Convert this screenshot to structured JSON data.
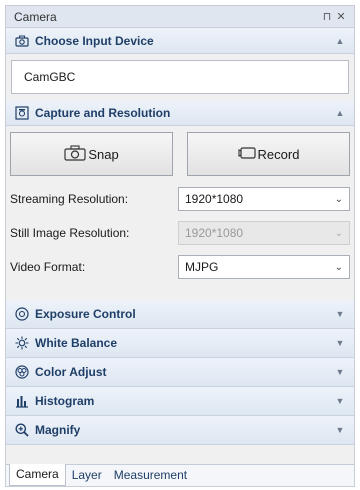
{
  "window": {
    "title": "Camera",
    "pin_glyph": "⊓",
    "close_glyph": "✕"
  },
  "sections": {
    "input_device": {
      "title": "Choose Input Device",
      "icon": "camera-icon",
      "device": "CamGBC"
    },
    "capture": {
      "title": "Capture and Resolution",
      "icon": "capture-icon",
      "snap_label": "Snap",
      "record_label": "Record",
      "streaming_label": "Streaming Resolution:",
      "streaming_value": "1920*1080",
      "still_label": "Still Image Resolution:",
      "still_value": "1920*1080",
      "format_label": "Video Format:",
      "format_value": "MJPG"
    },
    "exposure": {
      "title": "Exposure Control",
      "icon": "exposure-icon"
    },
    "white_balance": {
      "title": "White Balance",
      "icon": "white-balance-icon"
    },
    "color_adjust": {
      "title": "Color Adjust",
      "icon": "color-adjust-icon"
    },
    "histogram": {
      "title": "Histogram",
      "icon": "histogram-icon"
    },
    "magnify": {
      "title": "Magnify",
      "icon": "magnify-icon"
    }
  },
  "tabs": [
    "Camera",
    "Layer",
    "Measurement"
  ],
  "colors": {
    "header_text": "#1f3f68",
    "header_bg": "#dde6f1",
    "panel_bg": "#f0f0f0"
  }
}
